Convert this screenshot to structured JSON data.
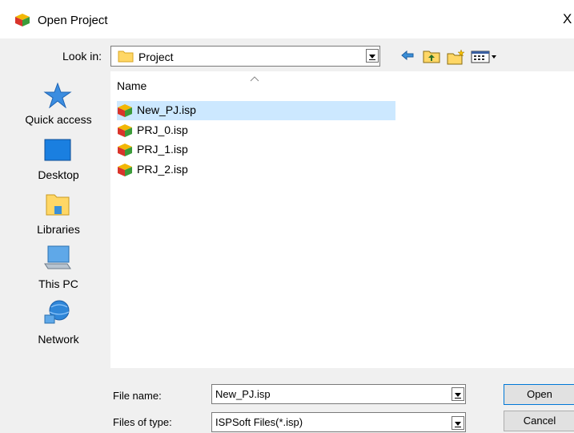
{
  "dialog": {
    "title": "Open Project",
    "close_glyph": "X"
  },
  "lookin": {
    "label": "Look in:",
    "value": "Project"
  },
  "toolbar": {
    "icons": [
      "back-icon",
      "up-folder-icon",
      "new-folder-icon",
      "view-menu-icon"
    ]
  },
  "places": [
    {
      "label": "Quick access",
      "icon": "star-icon"
    },
    {
      "label": "Desktop",
      "icon": "desktop-icon"
    },
    {
      "label": "Libraries",
      "icon": "libraries-icon"
    },
    {
      "label": "This PC",
      "icon": "computer-icon"
    },
    {
      "label": "Network",
      "icon": "network-icon"
    }
  ],
  "filelist": {
    "column_name": "Name",
    "files": [
      {
        "name": "New_PJ.isp",
        "selected": true
      },
      {
        "name": "PRJ_0.isp",
        "selected": false
      },
      {
        "name": "PRJ_1.isp",
        "selected": false
      },
      {
        "name": "PRJ_2.isp",
        "selected": false
      }
    ]
  },
  "bottom": {
    "file_name_label": "File name:",
    "file_name_value": "New_PJ.isp",
    "file_type_label": "Files of type:",
    "file_type_value": "ISPSoft Files(*.isp)",
    "open_label": "Open",
    "cancel_label": "Cancel"
  },
  "colors": {
    "selection": "#cce8ff",
    "accent": "#0078d7",
    "panel": "#f0f0f0"
  }
}
